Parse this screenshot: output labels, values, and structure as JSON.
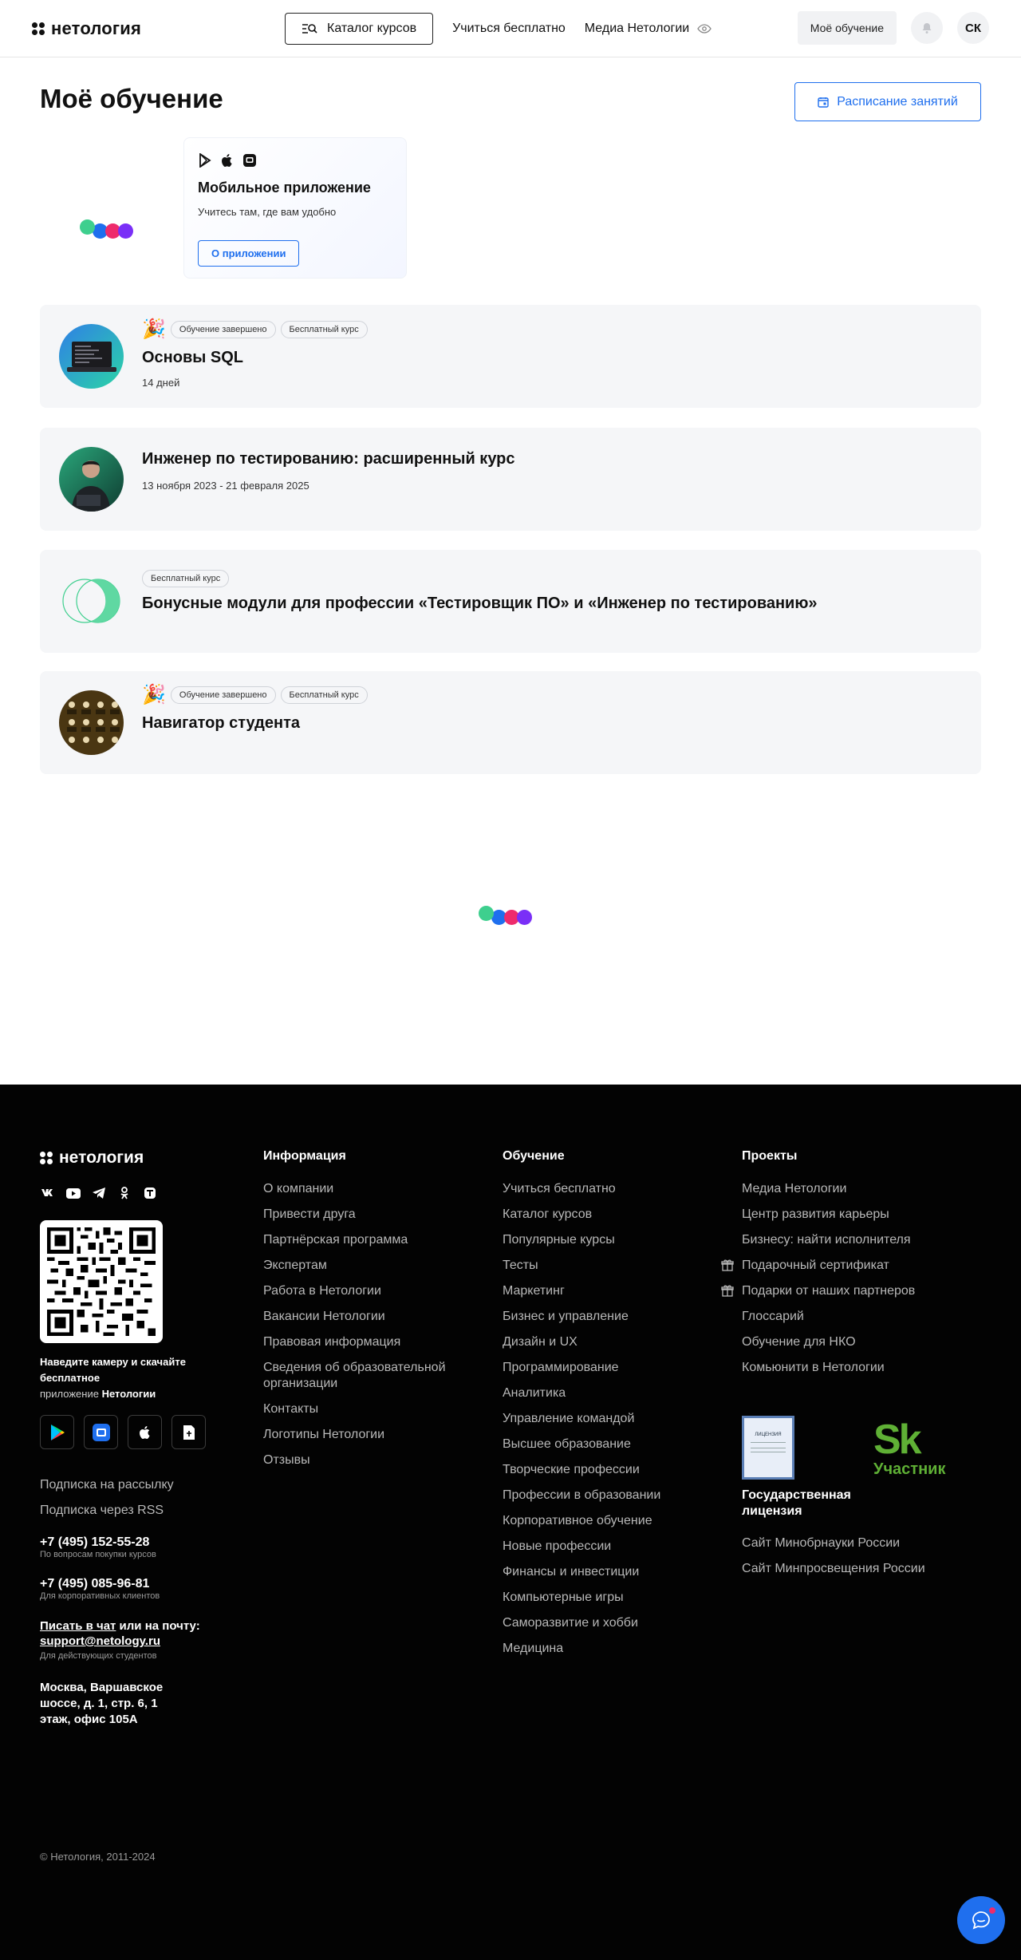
{
  "header": {
    "logo_text": "нетология",
    "catalog_label": "Каталог курсов",
    "nav": [
      "Учиться бесплатно",
      "Медиа Нетологии"
    ],
    "my_learning_label": "Моё обучение",
    "avatar_initials": "СК"
  },
  "main": {
    "title": "Моё обучение",
    "schedule_label": "Расписание занятий",
    "app_promo": {
      "title": "Мобильное приложение",
      "subtitle": "Учитесь там, где вам удобно",
      "button": "О приложении"
    },
    "courses": [
      {
        "title": "Основы SQL",
        "meta": "14 дней",
        "tags": [
          "Обучение завершено",
          "Бесплатный курс"
        ],
        "celebrate": true
      },
      {
        "title": "Инженер по тестированию: расширенный курс",
        "meta": "13 ноября 2023 - 21 февраля 2025",
        "tags": [],
        "celebrate": false
      },
      {
        "title": "Бонусные модули для профессии «Тестировщик ПО» и «Инженер по тестированию»",
        "meta": "",
        "tags": [
          "Бесплатный курс"
        ],
        "celebrate": false
      },
      {
        "title": "Навигатор студента",
        "meta": "",
        "tags": [
          "Обучение завершено",
          "Бесплатный курс"
        ],
        "celebrate": true
      }
    ]
  },
  "footer": {
    "logo_text": "нетология",
    "qr_text_1": "Наведите камеру и скачайте бесплатное",
    "qr_text_2": "приложение",
    "qr_text_3": "Нетологии",
    "subscribe": "Подписка на рассылку",
    "rss": "Подписка через RSS",
    "phone1": "+7 (495) 152-55-28",
    "phone1_note": "По вопросам покупки курсов",
    "phone2": "+7 (495) 085-96-81",
    "phone2_note": "Для корпоративных клиентов",
    "chat_link": "Писать в чат",
    "chat_mid": " или на почту:",
    "email": "support@netology.ru",
    "email_note": "Для действующих студентов",
    "address": "Москва, Варшавское шоссе, д. 1, стр. 6, 1 этаж, офис 105А",
    "copyright": "© Нетология, 2011-2024",
    "info_head": "Информация",
    "info": [
      "О компании",
      "Привести друга",
      "Партнёрская программа",
      "Экспертам",
      "Работа в Нетологии",
      "Вакансии Нетологии",
      "Правовая информация",
      "Сведения об образовательной организации",
      "Контакты",
      "Логотипы Нетологии",
      "Отзывы"
    ],
    "learn_head": "Обучение",
    "learn": [
      "Учиться бесплатно",
      "Каталог курсов",
      "Популярные курсы",
      "Тесты",
      "Маркетинг",
      "Бизнес и управление",
      "Дизайн и UX",
      "Программирование",
      "Аналитика",
      "Управление командой",
      "Высшее образование",
      "Творческие профессии",
      "Профессии в образовании",
      "Корпоративное обучение",
      "Новые профессии",
      "Финансы и инвестиции",
      "Компьютерные игры",
      "Саморазвитие и хобби",
      "Медицина"
    ],
    "proj_head": "Проекты",
    "proj": [
      "Медиа Нетологии",
      "Центр развития карьеры",
      "Бизнесу: найти исполнителя",
      "Подарочный сертификат",
      "Подарки от наших партнеров",
      "Глоссарий",
      "Обучение для НКО",
      "Комьюнити в Нетологии"
    ],
    "license_title": "Государственная лицензия",
    "license_doc": "ЛИЦЕНЗИЯ",
    "sk_logo": "Sk",
    "sk_label": "Участник",
    "minobr": "Сайт Минобрнауки России",
    "minpros": "Сайт Минпросвещения России"
  }
}
